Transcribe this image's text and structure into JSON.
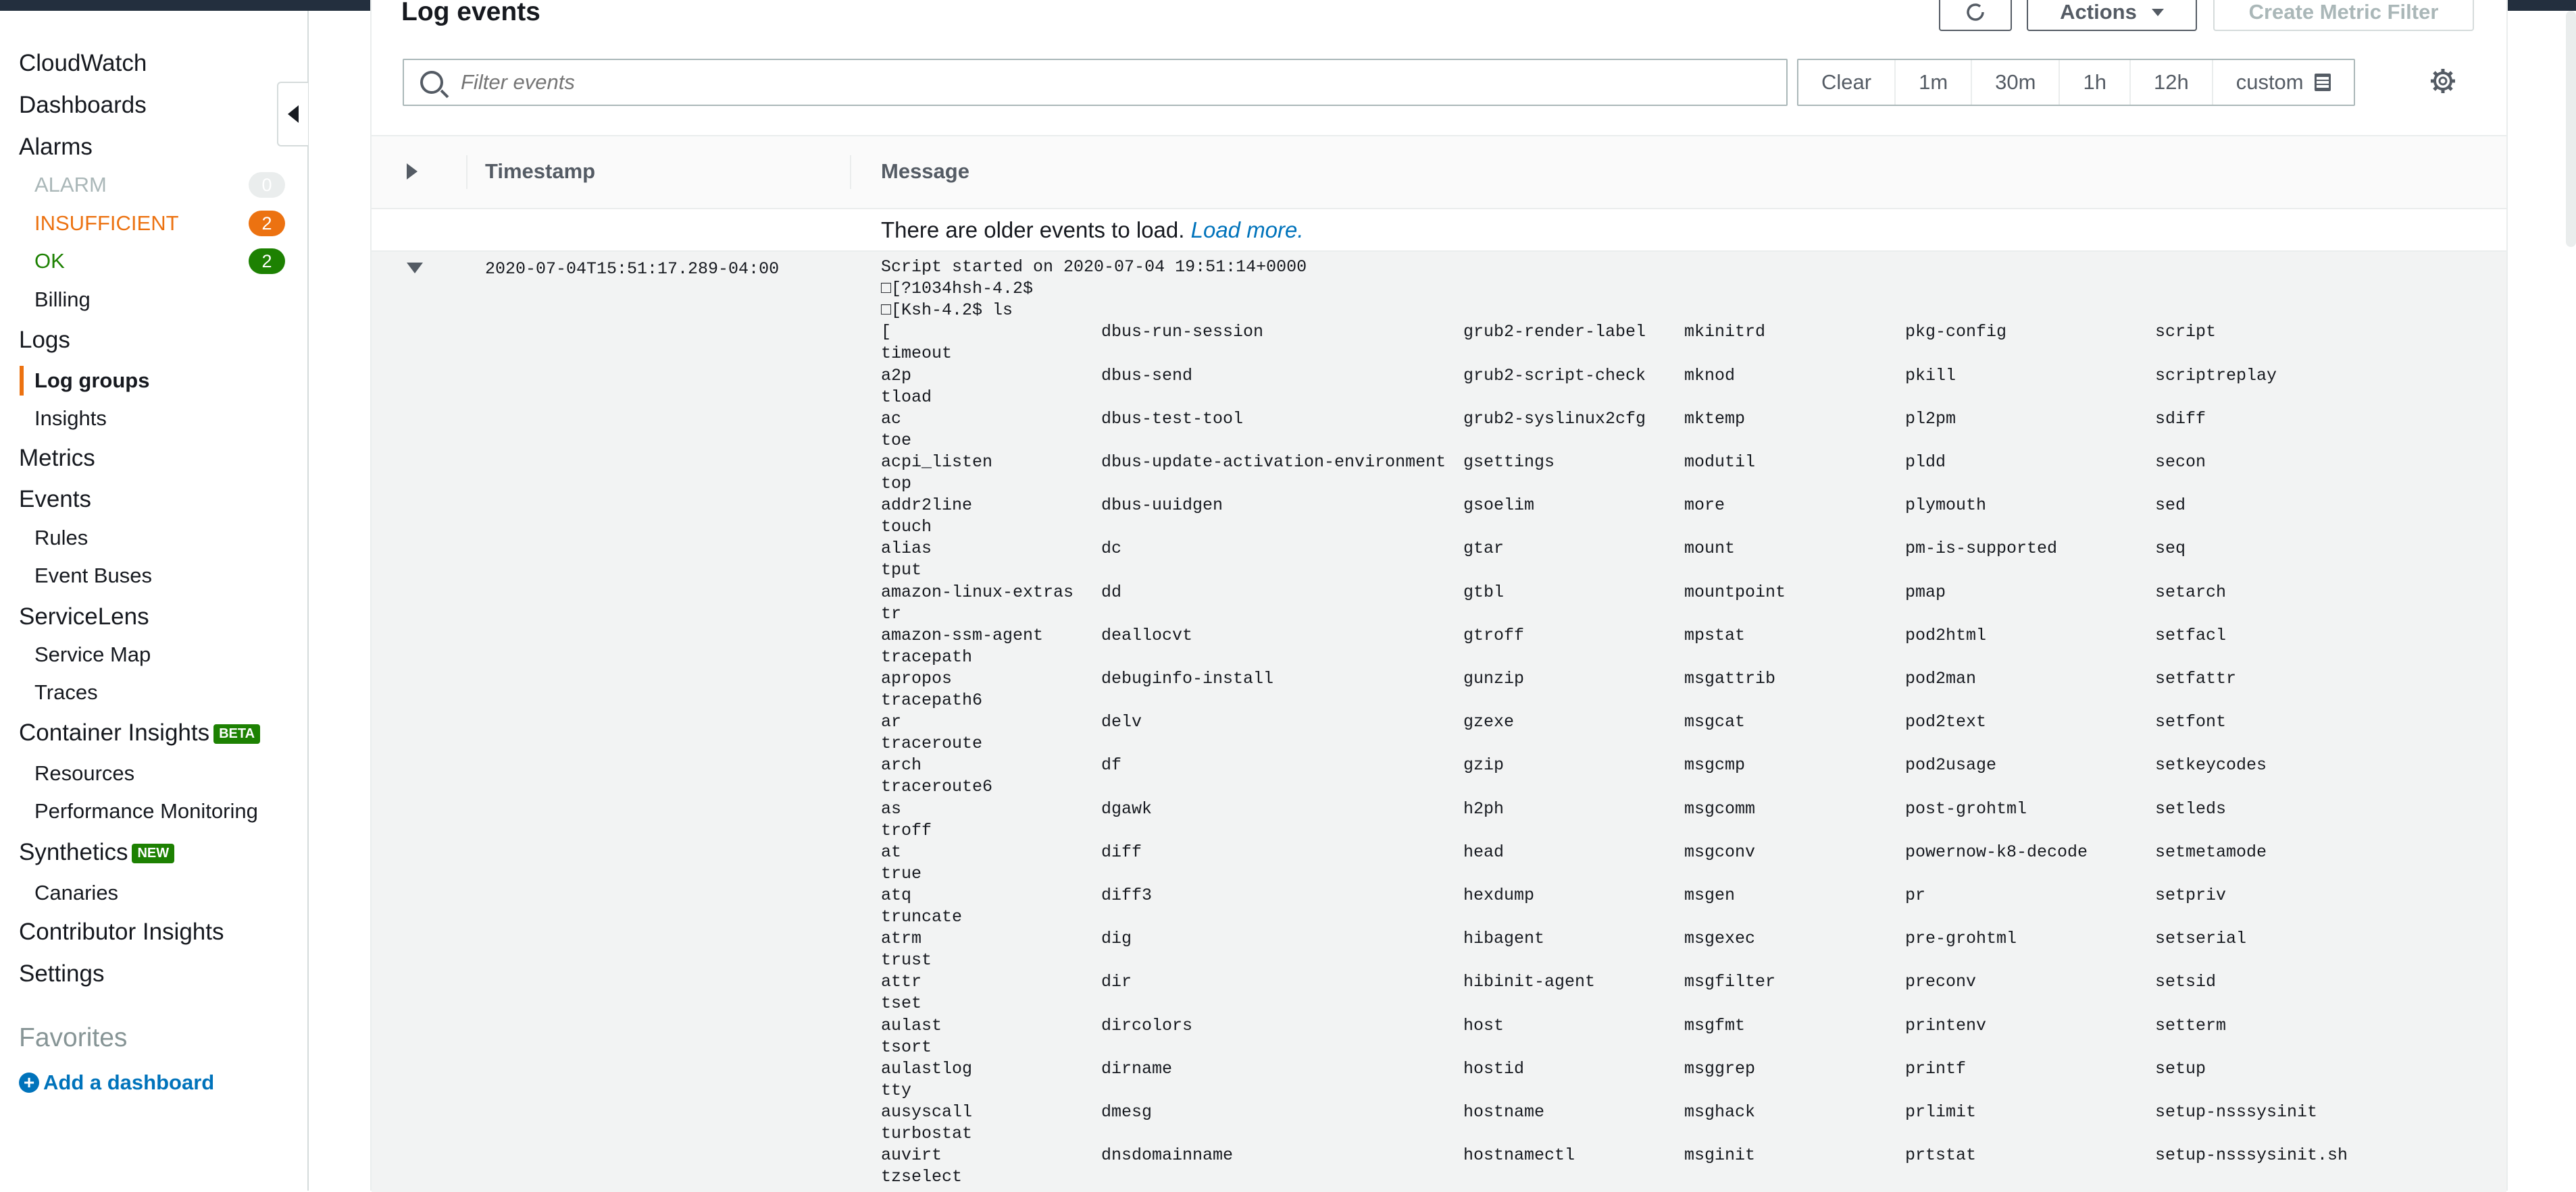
{
  "sidebar": {
    "items": [
      {
        "label": "CloudWatch",
        "level": "top"
      },
      {
        "label": "Dashboards",
        "level": "top"
      },
      {
        "label": "Alarms",
        "level": "top"
      },
      {
        "label": "ALARM",
        "level": "alarm",
        "count": "0",
        "color": "#aab7b8",
        "badge_color": "#eaeded"
      },
      {
        "label": "INSUFFICIENT",
        "level": "alarm",
        "count": "2",
        "color": "#ec7211",
        "badge_color": "#ec7211"
      },
      {
        "label": "OK",
        "level": "alarm",
        "count": "2",
        "color": "#1d8102",
        "badge_color": "#1d8102"
      },
      {
        "label": "Billing",
        "level": "sub"
      },
      {
        "label": "Logs",
        "level": "top"
      },
      {
        "label": "Log groups",
        "level": "sub",
        "active": true
      },
      {
        "label": "Insights",
        "level": "sub"
      },
      {
        "label": "Metrics",
        "level": "top"
      },
      {
        "label": "Events",
        "level": "top"
      },
      {
        "label": "Rules",
        "level": "sub"
      },
      {
        "label": "Event Buses",
        "level": "sub"
      },
      {
        "label": "ServiceLens",
        "level": "top"
      },
      {
        "label": "Service Map",
        "level": "sub"
      },
      {
        "label": "Traces",
        "level": "sub"
      },
      {
        "label": "Container Insights",
        "level": "top",
        "tag": "BETA"
      },
      {
        "label": "Resources",
        "level": "sub"
      },
      {
        "label": "Performance Monitoring",
        "level": "sub"
      },
      {
        "label": "Synthetics",
        "level": "top",
        "tag": "NEW"
      },
      {
        "label": "Canaries",
        "level": "sub"
      },
      {
        "label": "Contributor Insights",
        "level": "top"
      },
      {
        "label": "Settings",
        "level": "top"
      }
    ],
    "favorites_label": "Favorites",
    "add_dashboard_label": "Add a dashboard",
    "collapse_icon": "caret-left-icon"
  },
  "main": {
    "title": "Log events",
    "actions_label": "Actions",
    "create_metric_filter_label": "Create Metric Filter",
    "filter_placeholder": "Filter events",
    "ranges": [
      "Clear",
      "1m",
      "30m",
      "1h",
      "12h",
      "custom"
    ],
    "table": {
      "timestamp_header": "Timestamp",
      "message_header": "Message"
    },
    "older_events_text": "There are older events to load.",
    "load_more_label": "Load more.",
    "event": {
      "timestamp": "2020-07-04T15:51:17.289-04:00",
      "header_lines": [
        "Script started on 2020-07-04 19:51:14+0000",
        "□[?1034hsh-4.2$",
        "□[Ksh-4.2$ ls"
      ],
      "rows": [
        [
          "[",
          "dbus-run-session",
          "grub2-render-label",
          "mkinitrd",
          "pkg-config",
          "script",
          "timeout"
        ],
        [
          "a2p",
          "dbus-send",
          "grub2-script-check",
          "mknod",
          "pkill",
          "scriptreplay",
          "tload"
        ],
        [
          "ac",
          "dbus-test-tool",
          "grub2-syslinux2cfg",
          "mktemp",
          "pl2pm",
          "sdiff",
          "toe"
        ],
        [
          "acpi_listen",
          "dbus-update-activation-environment",
          "gsettings",
          "modutil",
          "pldd",
          "secon",
          "top"
        ],
        [
          "addr2line",
          "dbus-uuidgen",
          "gsoelim",
          "more",
          "plymouth",
          "sed",
          "touch"
        ],
        [
          "alias",
          "dc",
          "gtar",
          "mount",
          "pm-is-supported",
          "seq",
          "tput"
        ],
        [
          "amazon-linux-extras",
          "dd",
          "gtbl",
          "mountpoint",
          "pmap",
          "setarch",
          "tr"
        ],
        [
          "amazon-ssm-agent",
          "deallocvt",
          "gtroff",
          "mpstat",
          "pod2html",
          "setfacl",
          "tracepath"
        ],
        [
          "apropos",
          "debuginfo-install",
          "gunzip",
          "msgattrib",
          "pod2man",
          "setfattr",
          "tracepath6"
        ],
        [
          "ar",
          "delv",
          "gzexe",
          "msgcat",
          "pod2text",
          "setfont",
          "traceroute"
        ],
        [
          "arch",
          "df",
          "gzip",
          "msgcmp",
          "pod2usage",
          "setkeycodes",
          "traceroute6"
        ],
        [
          "as",
          "dgawk",
          "h2ph",
          "msgcomm",
          "post-grohtml",
          "setleds",
          "troff"
        ],
        [
          "at",
          "diff",
          "head",
          "msgconv",
          "powernow-k8-decode",
          "setmetamode",
          "true"
        ],
        [
          "atq",
          "diff3",
          "hexdump",
          "msgen",
          "pr",
          "setpriv",
          "truncate"
        ],
        [
          "atrm",
          "dig",
          "hibagent",
          "msgexec",
          "pre-grohtml",
          "setserial",
          "trust"
        ],
        [
          "attr",
          "dir",
          "hibinit-agent",
          "msgfilter",
          "preconv",
          "setsid",
          "tset"
        ],
        [
          "aulast",
          "dircolors",
          "host",
          "msgfmt",
          "printenv",
          "setterm",
          "tsort"
        ],
        [
          "aulastlog",
          "dirname",
          "hostid",
          "msggrep",
          "printf",
          "setup",
          "tty"
        ],
        [
          "ausyscall",
          "dmesg",
          "hostname",
          "msghack",
          "prlimit",
          "setup-nsssysinit",
          "turbostat"
        ],
        [
          "auvirt",
          "dnsdomainname",
          "hostnamectl",
          "msginit",
          "prtstat",
          "setup-nsssysinit.sh",
          "tzselect"
        ]
      ]
    }
  }
}
